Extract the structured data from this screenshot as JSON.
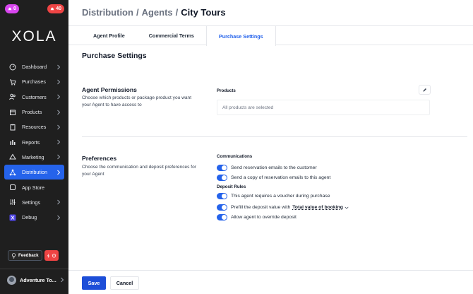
{
  "sidebar": {
    "badge_left": "0",
    "badge_right": "40",
    "logo": "XOLA",
    "items": [
      {
        "label": "Dashboard",
        "icon": "dashboard-icon"
      },
      {
        "label": "Purchases",
        "icon": "cart-icon"
      },
      {
        "label": "Customers",
        "icon": "customers-icon"
      },
      {
        "label": "Products",
        "icon": "box-icon"
      },
      {
        "label": "Resources",
        "icon": "clipboard-icon"
      },
      {
        "label": "Reports",
        "icon": "bar-chart-icon"
      },
      {
        "label": "Marketing",
        "icon": "megaphone-icon"
      },
      {
        "label": "Distribution",
        "icon": "network-icon",
        "active": true
      },
      {
        "label": "App Store",
        "icon": "app-store-icon"
      },
      {
        "label": "Settings",
        "icon": "sliders-icon"
      },
      {
        "label": "Debug",
        "icon": "debug-icon"
      }
    ],
    "feedback_label": "Feedback",
    "account_name": "Adventure To..."
  },
  "breadcrumb": {
    "part1": "Distribution",
    "part2": "Agents",
    "current": "City Tours",
    "separator": "/"
  },
  "tabs": [
    "Agent Profile",
    "Commercial Terms",
    "Purchase Settings"
  ],
  "active_tab": "Purchase Settings",
  "page_title": "Purchase Settings",
  "agent_permissions": {
    "title": "Agent Permissions",
    "description": "Choose which products or package product you want your Agent to have access to",
    "products_label": "Products",
    "products_value": "All products are selected"
  },
  "preferences": {
    "title": "Preferences",
    "description": "Choose the communication and deposit preferences for your Agent",
    "communications_label": "Communications",
    "communications": [
      "Send reservation emails to the customer",
      "Send a copy of reservation emails to this agent"
    ],
    "deposit_label": "Deposit Rules",
    "deposit_rule_1": "This agent requires a voucher during purchase",
    "deposit_rule_2_prefix": "Prefill the deposit value with",
    "deposit_rule_2_value": "Total value of booking",
    "deposit_rule_3": "Allow agent to override deposit"
  },
  "footer": {
    "save": "Save",
    "cancel": "Cancel"
  },
  "colors": {
    "accent": "#2563eb",
    "sidebar_bg": "#1f1f1f",
    "badge_purple": "#d946ef",
    "badge_red": "#ef4444"
  }
}
